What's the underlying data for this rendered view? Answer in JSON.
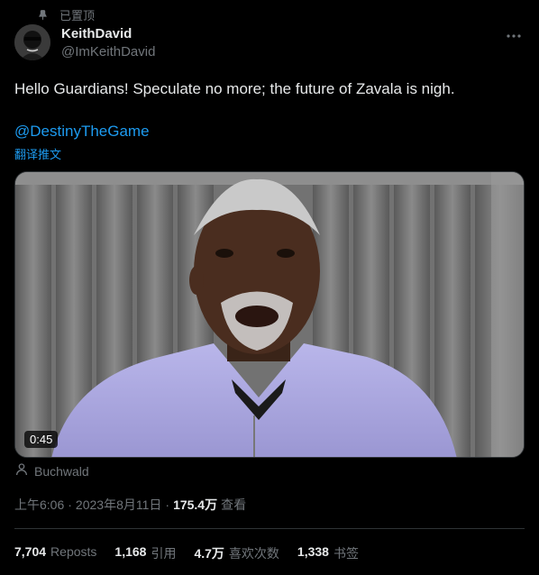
{
  "pinned": {
    "label": "已置顶",
    "icon": "pin-icon"
  },
  "author": {
    "name": "KeithDavid",
    "handle": "@ImKeithDavid"
  },
  "tweet": {
    "text": "Hello Guardians! Speculate no more; the future of Zavala is nigh.",
    "mention": "@DestinyTheGame",
    "translate": "翻译推文"
  },
  "media": {
    "duration": "0:45",
    "credit": "Buchwald"
  },
  "meta": {
    "time": "上午6:06",
    "separator1": "·",
    "date": "2023年8月11日",
    "separator2": "·",
    "views_count": "175.4万",
    "views_label": "查看"
  },
  "stats": [
    {
      "num": "7,704",
      "label": "Reposts"
    },
    {
      "num": "1,168",
      "label": "引用"
    },
    {
      "num": "4.7万",
      "label": "喜欢次数"
    },
    {
      "num": "1,338",
      "label": "书签"
    }
  ],
  "colors": {
    "accent": "#1d9bf0",
    "muted": "#71767b",
    "text": "#e7e9ea",
    "background": "#000000"
  }
}
